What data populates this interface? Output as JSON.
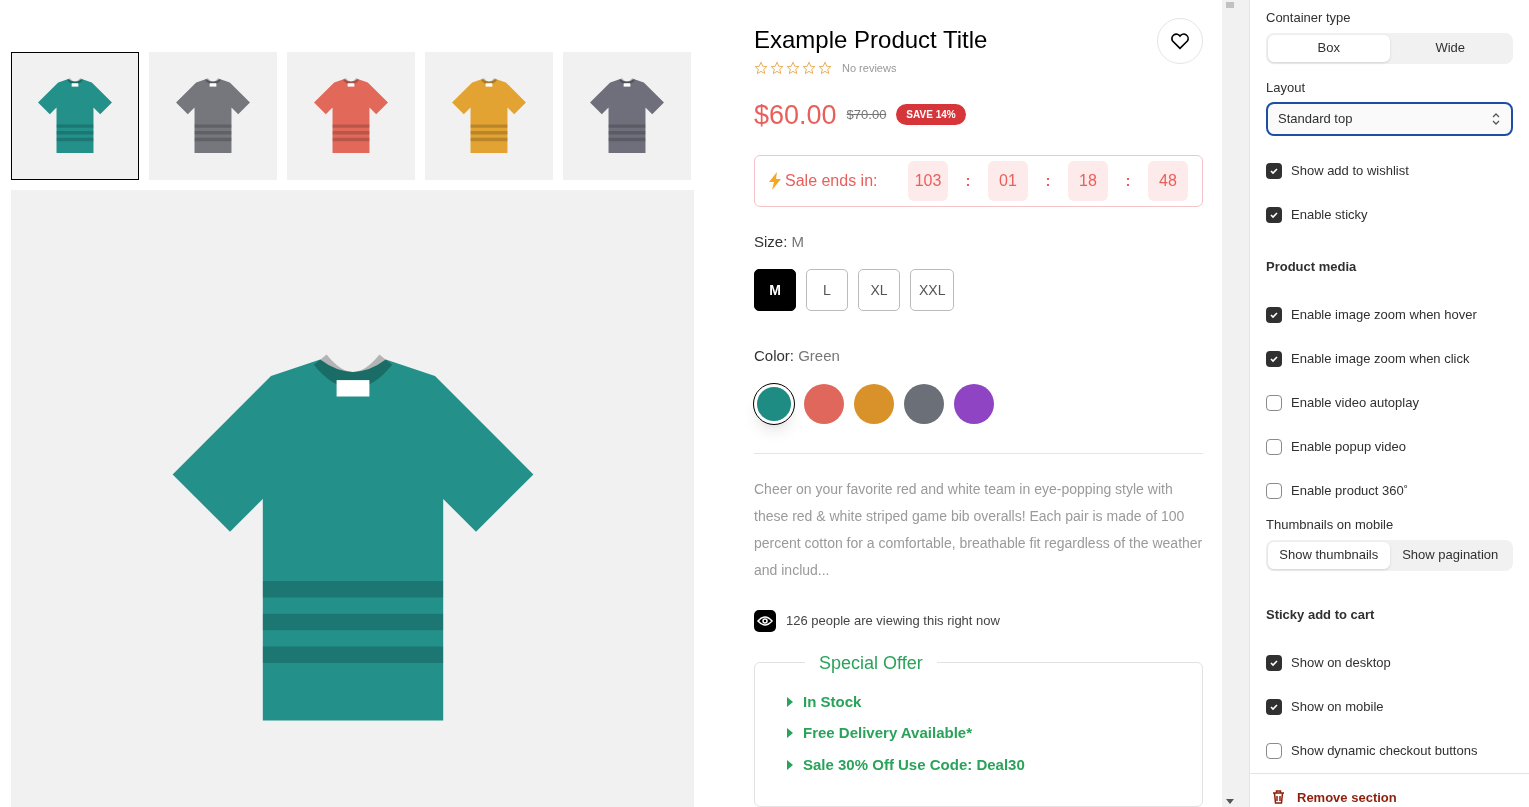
{
  "gallery": {
    "thumbnails": [
      {
        "color": "#23918a",
        "selected": true
      },
      {
        "color": "#75777d",
        "selected": false
      },
      {
        "color": "#e2695a",
        "selected": false
      },
      {
        "color": "#e3a332",
        "selected": false
      },
      {
        "color": "#6e6f7b",
        "selected": false
      }
    ]
  },
  "product": {
    "title": "Example Product Title",
    "stars": 0,
    "reviews": "No reviews",
    "price": "$60.00",
    "compare_price": "$70.00",
    "badge": "SAVE 14%",
    "countdown": {
      "label": "Sale ends in:",
      "units": [
        "103",
        "01",
        "18",
        "48"
      ],
      "separator": ":"
    },
    "size": {
      "label": "Size:",
      "value": "M",
      "options": [
        {
          "label": "M",
          "selected": true
        },
        {
          "label": "L",
          "selected": false
        },
        {
          "label": "XL",
          "selected": false
        },
        {
          "label": "XXL",
          "selected": false
        }
      ]
    },
    "color": {
      "label": "Color:",
      "value": "Green",
      "swatches": [
        {
          "color": "#1f8c84",
          "selected": true
        },
        {
          "color": "#e0675b",
          "selected": false
        },
        {
          "color": "#d9912a",
          "selected": false
        },
        {
          "color": "#6b7078",
          "selected": false
        },
        {
          "color": "#8e44c3",
          "selected": false
        }
      ]
    },
    "description": "Cheer on your favorite red and white team in eye-popping style with these red & white striped game bib overalls! Each pair is made of 100 percent cotton for a comfortable, breathable fit regardless of the weather and includ...",
    "viewers": "126 people are viewing this right now",
    "special_offer": {
      "title": "Special Offer",
      "items": [
        "In Stock",
        "Free Delivery Available*",
        "Sale 30% Off Use Code: Deal30"
      ]
    }
  },
  "settings": [
    {
      "kind": "segmented",
      "label": "Container type",
      "options": [
        {
          "label": "Box",
          "selected": true
        },
        {
          "label": "Wide",
          "selected": false
        }
      ]
    },
    {
      "kind": "select",
      "label": "Layout",
      "value": "Standard top"
    },
    {
      "kind": "checkbox",
      "label": "Show add to wishlist",
      "checked": true
    },
    {
      "kind": "checkbox",
      "label": "Enable sticky",
      "checked": true
    },
    {
      "kind": "heading",
      "label": "Product media"
    },
    {
      "kind": "checkbox",
      "label": "Enable image zoom when hover",
      "checked": true
    },
    {
      "kind": "checkbox",
      "label": "Enable image zoom when click",
      "checked": true
    },
    {
      "kind": "checkbox",
      "label": "Enable video autoplay",
      "checked": false
    },
    {
      "kind": "checkbox",
      "label": "Enable popup video",
      "checked": false
    },
    {
      "kind": "checkbox",
      "label": "Enable product 360˚",
      "checked": false
    },
    {
      "kind": "segmented",
      "label": "Thumbnails on mobile",
      "options": [
        {
          "label": "Show thumbnails",
          "selected": true
        },
        {
          "label": "Show pagination",
          "selected": false
        }
      ]
    },
    {
      "kind": "heading",
      "label": "Sticky add to cart"
    },
    {
      "kind": "checkbox",
      "label": "Show on desktop",
      "checked": true
    },
    {
      "kind": "checkbox",
      "label": "Show on mobile",
      "checked": true
    },
    {
      "kind": "checkbox",
      "label": "Show dynamic checkout buttons",
      "checked": false
    }
  ],
  "remove_section": "Remove section"
}
